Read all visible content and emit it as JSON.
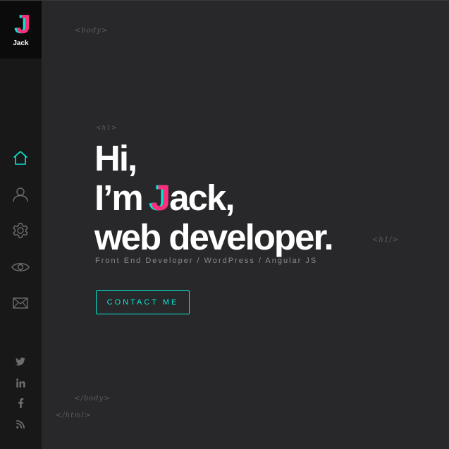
{
  "brand": {
    "logo_letter": "J",
    "name": "Jack"
  },
  "tags": {
    "body_open": "<body>",
    "h1_open": "<h1>",
    "h1_close": "<h1/>",
    "body_close": "</body>",
    "html_close": "</html>"
  },
  "hero": {
    "line1": "Hi,",
    "line2_prefix": "I’m ",
    "line2_accent": "J",
    "line2_suffix": "ack,",
    "line3": "web developer.",
    "subtitle": "Front End Developer / WordPress / Angular JS",
    "button_label": "CONTACT ME"
  },
  "nav": [
    {
      "icon": "home-icon",
      "active": true
    },
    {
      "icon": "user-icon",
      "active": false
    },
    {
      "icon": "gear-icon",
      "active": false
    },
    {
      "icon": "eye-icon",
      "active": false
    },
    {
      "icon": "mail-icon",
      "active": false
    }
  ],
  "social": [
    "twitter-icon",
    "linkedin-icon",
    "facebook-icon",
    "rss-icon"
  ],
  "colors": {
    "accent_teal": "#08e8d3",
    "accent_pink": "#ff2e7d",
    "background": "#28282a",
    "sidebar": "#181819",
    "text": "#ffffff",
    "muted": "#8a8a8d"
  }
}
